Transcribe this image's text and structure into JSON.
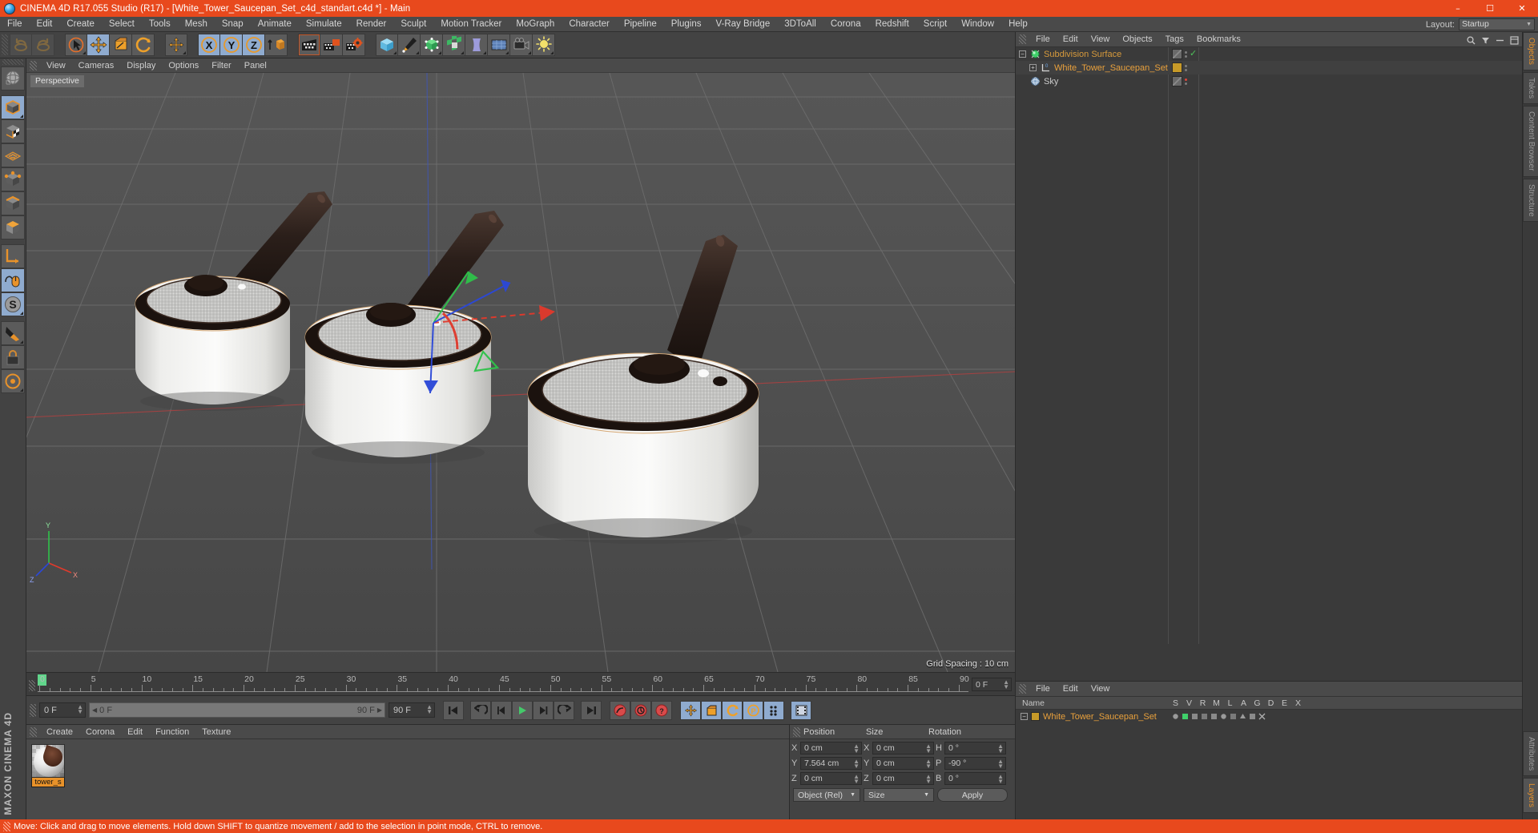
{
  "window": {
    "title": "CINEMA 4D R17.055 Studio (R17) - [White_Tower_Saucepan_Set_c4d_standart.c4d *] - Main",
    "app_icon": "c4d-logo-icon",
    "minimize": "–",
    "maximize": "☐",
    "close": "✕"
  },
  "menubar": {
    "items": [
      {
        "label": "File"
      },
      {
        "label": "Edit"
      },
      {
        "label": "Create"
      },
      {
        "label": "Select"
      },
      {
        "label": "Tools"
      },
      {
        "label": "Mesh"
      },
      {
        "label": "Snap"
      },
      {
        "label": "Animate"
      },
      {
        "label": "Simulate"
      },
      {
        "label": "Render"
      },
      {
        "label": "Sculpt"
      },
      {
        "label": "Motion Tracker"
      },
      {
        "label": "MoGraph"
      },
      {
        "label": "Character"
      },
      {
        "label": "Pipeline"
      },
      {
        "label": "Plugins"
      },
      {
        "label": "V-Ray Bridge"
      },
      {
        "label": "3DToAll"
      },
      {
        "label": "Corona"
      },
      {
        "label": "Redshift"
      },
      {
        "label": "Script"
      },
      {
        "label": "Window"
      },
      {
        "label": "Help"
      }
    ],
    "layout_label": "Layout:",
    "layout_value": "Startup"
  },
  "toolbar": {
    "buttons": [
      {
        "name": "undo-button",
        "icon": "undo-arrow-icon",
        "state": "disabled"
      },
      {
        "name": "redo-button",
        "icon": "redo-arrow-icon",
        "state": "disabled"
      },
      {
        "name": "live-selection-tool",
        "icon": "cursor-circle-icon",
        "state": "off"
      },
      {
        "name": "move-tool",
        "icon": "move-arrows-icon",
        "state": "active"
      },
      {
        "name": "scale-tool",
        "icon": "scale-box-icon",
        "state": "off"
      },
      {
        "name": "rotate-tool",
        "icon": "rotate-circle-icon",
        "state": "off"
      },
      {
        "name": "transform-tool",
        "icon": "move-arrows-icon",
        "state": "off"
      },
      {
        "name": "lock-x-axis",
        "icon": "axis-x-icon",
        "state": "active",
        "label": "X"
      },
      {
        "name": "lock-y-axis",
        "icon": "axis-y-icon",
        "state": "active",
        "label": "Y"
      },
      {
        "name": "lock-z-axis",
        "icon": "axis-z-icon",
        "state": "active",
        "label": "Z"
      },
      {
        "name": "world-object-coordinates",
        "icon": "world-axis-cube-icon",
        "state": "off"
      },
      {
        "name": "render-view",
        "icon": "clapper-board-icon",
        "state": "off"
      },
      {
        "name": "render-region",
        "icon": "clapper-region-icon",
        "state": "off"
      },
      {
        "name": "render-settings",
        "icon": "clapper-gear-icon",
        "state": "off"
      },
      {
        "name": "add-cube-primitive",
        "icon": "blue-cube-icon",
        "state": "off"
      },
      {
        "name": "add-spline",
        "icon": "pen-nib-icon",
        "state": "off"
      },
      {
        "name": "add-generator",
        "icon": "green-subdivision-cube-icon",
        "state": "off"
      },
      {
        "name": "add-array-object",
        "icon": "green-cluster-icon",
        "state": "off"
      },
      {
        "name": "add-deformer",
        "icon": "purple-bend-icon",
        "state": "off"
      },
      {
        "name": "add-environment",
        "icon": "environment-grid-icon",
        "state": "off"
      },
      {
        "name": "add-camera",
        "icon": "camera-icon",
        "state": "off"
      },
      {
        "name": "add-light",
        "icon": "light-bulb-icon",
        "state": "off"
      }
    ]
  },
  "left_palette": {
    "buttons": [
      {
        "name": "viewport-navigation-tool",
        "icon": "globe-wire-icon",
        "state": "off"
      },
      {
        "name": "model-mode",
        "icon": "model-cube-icon",
        "state": "active"
      },
      {
        "name": "texture-mode",
        "icon": "texture-checker-cube-icon",
        "state": "off"
      },
      {
        "name": "polygon-mode",
        "icon": "polygon-grid-icon",
        "state": "off"
      },
      {
        "name": "point-mode",
        "icon": "point-cube-icon",
        "state": "off"
      },
      {
        "name": "edge-mode",
        "icon": "edge-cube-icon",
        "state": "off"
      },
      {
        "name": "object-mode",
        "icon": "object-cube-icon",
        "state": "off"
      },
      {
        "name": "axis-modify-tool",
        "icon": "axis-corner-icon",
        "state": "off"
      },
      {
        "name": "enable-snapping",
        "icon": "mouse-magnet-icon",
        "state": "active"
      },
      {
        "name": "workplane-tool",
        "icon": "s-disc-icon",
        "state": "active"
      },
      {
        "name": "knife-tool",
        "icon": "knife-icon",
        "state": "off"
      },
      {
        "name": "lock-tool",
        "icon": "padlock-icon",
        "state": "off"
      },
      {
        "name": "viewport-solo",
        "icon": "solo-circle-icon",
        "state": "off"
      }
    ],
    "brand": "MAXON CINEMA 4D"
  },
  "viewport": {
    "menus": [
      {
        "label": "View"
      },
      {
        "label": "Cameras"
      },
      {
        "label": "Display"
      },
      {
        "label": "Options"
      },
      {
        "label": "Filter"
      },
      {
        "label": "Panel"
      }
    ],
    "corner_icons": [
      {
        "name": "pan-view-icon"
      },
      {
        "name": "dolly-view-icon"
      },
      {
        "name": "rotate-view-icon"
      },
      {
        "name": "maximize-view-icon"
      }
    ],
    "view_label": "Perspective",
    "grid_spacing": "Grid Spacing : 10 cm",
    "axis_gizmo": {
      "x": "X",
      "y": "Y",
      "z": "Z"
    },
    "scene_description": "Three white enamel saucepans with dark handles arranged diagonally on a perspective grid floor, move-tool gizmo with red/green/blue axis arrows at centre"
  },
  "timeline": {
    "ticks": [
      "0",
      "5",
      "10",
      "15",
      "20",
      "25",
      "30",
      "35",
      "40",
      "45",
      "50",
      "55",
      "60",
      "65",
      "70",
      "75",
      "80",
      "85",
      "90"
    ],
    "current_frame_box": "0 F",
    "marker_frame": 0
  },
  "transport": {
    "current_frame": "0 F",
    "range_start": "0 F",
    "range_end": "90 F",
    "end_frame_field": "90 F",
    "buttons": [
      {
        "name": "go-to-start-button",
        "icon": "skip-start-icon",
        "state": "off"
      },
      {
        "name": "play-backwards-loop-button",
        "icon": "loop-back-icon",
        "state": "off"
      },
      {
        "name": "previous-frame-button",
        "icon": "step-back-icon",
        "state": "off"
      },
      {
        "name": "play-button",
        "icon": "play-triangle-icon",
        "state": "off"
      },
      {
        "name": "next-frame-button",
        "icon": "step-forward-icon",
        "state": "off"
      },
      {
        "name": "play-forwards-loop-button",
        "icon": "loop-forward-icon",
        "state": "off"
      },
      {
        "name": "go-to-end-button",
        "icon": "skip-end-icon",
        "state": "off"
      },
      {
        "name": "record-active-objects-button",
        "icon": "record-circle-icon",
        "state": "off"
      },
      {
        "name": "autokeying-button",
        "icon": "autokey-circle-icon",
        "state": "off"
      },
      {
        "name": "keyframe-selection-button",
        "icon": "key-question-icon",
        "state": "off"
      },
      {
        "name": "record-position-button",
        "icon": "position-key-icon",
        "state": "active"
      },
      {
        "name": "record-scale-button",
        "icon": "scale-key-icon",
        "state": "active"
      },
      {
        "name": "record-rotation-button",
        "icon": "rotation-key-icon",
        "state": "active"
      },
      {
        "name": "record-pla-button",
        "icon": "pla-key-icon",
        "state": "active"
      },
      {
        "name": "record-parameter-button",
        "icon": "param-key-icon",
        "state": "active"
      },
      {
        "name": "timeline-mode-button",
        "icon": "timeline-strip-icon",
        "state": "active"
      }
    ]
  },
  "material_manager": {
    "menus": [
      {
        "label": "Create"
      },
      {
        "label": "Corona"
      },
      {
        "label": "Edit"
      },
      {
        "label": "Function"
      },
      {
        "label": "Texture"
      }
    ],
    "materials": [
      {
        "name": "tower_s",
        "thumb": "sphere-material-preview"
      }
    ]
  },
  "coordinates": {
    "headers": [
      "Position",
      "Size",
      "Rotation"
    ],
    "rows": [
      {
        "p_label": "X",
        "p_value": "0 cm",
        "s_label": "X",
        "s_value": "0 cm",
        "r_label": "H",
        "r_value": "0 °"
      },
      {
        "p_label": "Y",
        "p_value": "7.564 cm",
        "s_label": "Y",
        "s_value": "0 cm",
        "r_label": "P",
        "r_value": "-90 °"
      },
      {
        "p_label": "Z",
        "p_value": "0 cm",
        "s_label": "Z",
        "s_value": "0 cm",
        "r_label": "B",
        "r_value": "0 °"
      }
    ],
    "coord_system": "Object (Rel)",
    "size_mode": "Size",
    "apply_label": "Apply"
  },
  "statusbar": {
    "message": "Move: Click and drag to move elements. Hold down SHIFT to quantize movement / add to the selection in point mode, CTRL to remove."
  },
  "object_manager": {
    "menus": [
      {
        "label": "File"
      },
      {
        "label": "Edit"
      },
      {
        "label": "View"
      },
      {
        "label": "Objects"
      },
      {
        "label": "Tags"
      },
      {
        "label": "Bookmarks"
      }
    ],
    "tool_icons": [
      {
        "name": "search-objects-icon"
      },
      {
        "name": "filter-objects-icon"
      },
      {
        "name": "collapse-panel-icon"
      },
      {
        "name": "panel-menu-icon"
      }
    ],
    "rows": [
      {
        "label": "Subdivision Surface",
        "icon": "subdivision-surface-icon",
        "depth": 0,
        "expand": "−",
        "color": "#d79a3c",
        "tag_swatch": "none",
        "enable_marker": "check",
        "marker_color": "#4ec35a"
      },
      {
        "label": "White_Tower_Saucepan_Set",
        "icon": "polygon-object-icon",
        "depth": 1,
        "expand": "+",
        "color": "#e8a03c",
        "tag_swatch": "#c79a28",
        "enable_marker": "none",
        "marker_color": "#7d7d7d"
      },
      {
        "label": "Sky",
        "icon": "sky-object-icon",
        "depth": 0,
        "expand": "",
        "color": "#cccccc",
        "tag_swatch": "none",
        "enable_marker": "dot",
        "marker_color": "#e0453a"
      }
    ]
  },
  "layer_manager": {
    "menus": [
      {
        "label": "File"
      },
      {
        "label": "Edit"
      },
      {
        "label": "View"
      }
    ],
    "name_header": "Name",
    "column_headers": [
      "S",
      "V",
      "R",
      "M",
      "L",
      "A",
      "G",
      "D",
      "E",
      "X"
    ],
    "rows": [
      {
        "name": "White_Tower_Saucepan_Set",
        "swatch": "#c79a28",
        "expand": "−"
      }
    ]
  },
  "vertical_tabs": {
    "top": [
      {
        "label": "Objects",
        "active": true
      },
      {
        "label": "Takes",
        "active": false
      },
      {
        "label": "Content Browser",
        "active": false
      },
      {
        "label": "Structure",
        "active": false
      }
    ],
    "bottom": [
      {
        "label": "Attributes",
        "active": false
      },
      {
        "label": "Layers",
        "active": true
      }
    ]
  },
  "colors": {
    "accent_orange": "#e8491d",
    "panel_bg": "#434343",
    "dark_bg": "#3a3a3a",
    "active_blue": "#8fabcf",
    "highlight_orange": "#e8922a",
    "viewport_bg": "#4e4e4e"
  }
}
